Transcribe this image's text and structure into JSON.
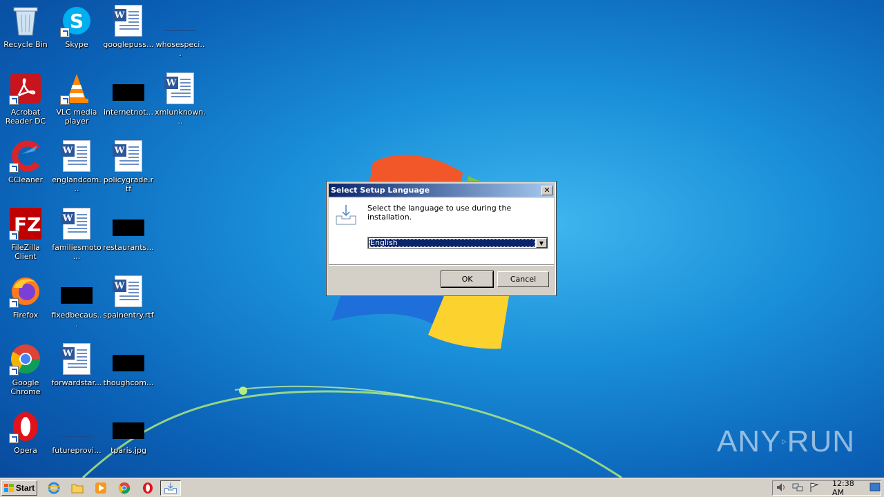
{
  "desktop": {
    "icons": [
      {
        "label": "Recycle Bin",
        "icon": "recycle-bin-icon"
      },
      {
        "label": "Skype",
        "icon": "skype-icon"
      },
      {
        "label": "googlepuss...",
        "icon": "word-document-icon"
      },
      {
        "label": "whosespeci...",
        "icon": "blank-file-icon"
      },
      {
        "label": "Acrobat Reader DC",
        "icon": "acrobat-icon"
      },
      {
        "label": "VLC media player",
        "icon": "vlc-icon"
      },
      {
        "label": "internetnot...",
        "icon": "redacted-file-icon"
      },
      {
        "label": "xmlunknown...",
        "icon": "word-document-icon"
      },
      {
        "label": "CCleaner",
        "icon": "ccleaner-icon"
      },
      {
        "label": "englandcom...",
        "icon": "word-document-icon"
      },
      {
        "label": "policygrade.rtf",
        "icon": "word-document-icon"
      },
      {
        "label": "FileZilla Client",
        "icon": "filezilla-icon"
      },
      {
        "label": "familiesmoto...",
        "icon": "word-document-icon"
      },
      {
        "label": "restaurants...",
        "icon": "redacted-file-icon"
      },
      {
        "label": "Firefox",
        "icon": "firefox-icon"
      },
      {
        "label": "fixedbecaus...",
        "icon": "redacted-file-icon"
      },
      {
        "label": "spainentry.rtf",
        "icon": "word-document-icon"
      },
      {
        "label": "Google Chrome",
        "icon": "chrome-icon"
      },
      {
        "label": "forwardstar...",
        "icon": "word-document-icon"
      },
      {
        "label": "thoughcom...",
        "icon": "redacted-file-icon"
      },
      {
        "label": "Opera",
        "icon": "opera-icon"
      },
      {
        "label": "futureprovi...",
        "icon": "blank-file-icon"
      },
      {
        "label": "tparis.jpg",
        "icon": "redacted-file-icon"
      }
    ]
  },
  "dialog": {
    "title": "Select Setup Language",
    "close_label": "✕",
    "instruction": "Select the language to use during the installation.",
    "language_selected": "English",
    "ok_label": "OK",
    "cancel_label": "Cancel"
  },
  "taskbar": {
    "start_label": "Start",
    "clock": "12:38 AM",
    "quick_launch": [
      "internet-explorer-icon",
      "explorer-folder-icon",
      "media-player-icon",
      "chrome-icon",
      "opera-icon"
    ],
    "active_task": "setup-installer-icon",
    "tray_icons": [
      "speaker-icon",
      "network-icon",
      "action-center-flag-icon",
      "show-desktop-icon"
    ]
  },
  "watermark": {
    "text_left": "ANY",
    "text_right": "RUN"
  },
  "colors": {
    "titlebar_start": "#0a246a",
    "titlebar_end": "#a6caf0",
    "dialog_face": "#d4d0c8",
    "selection": "#0a246a"
  }
}
